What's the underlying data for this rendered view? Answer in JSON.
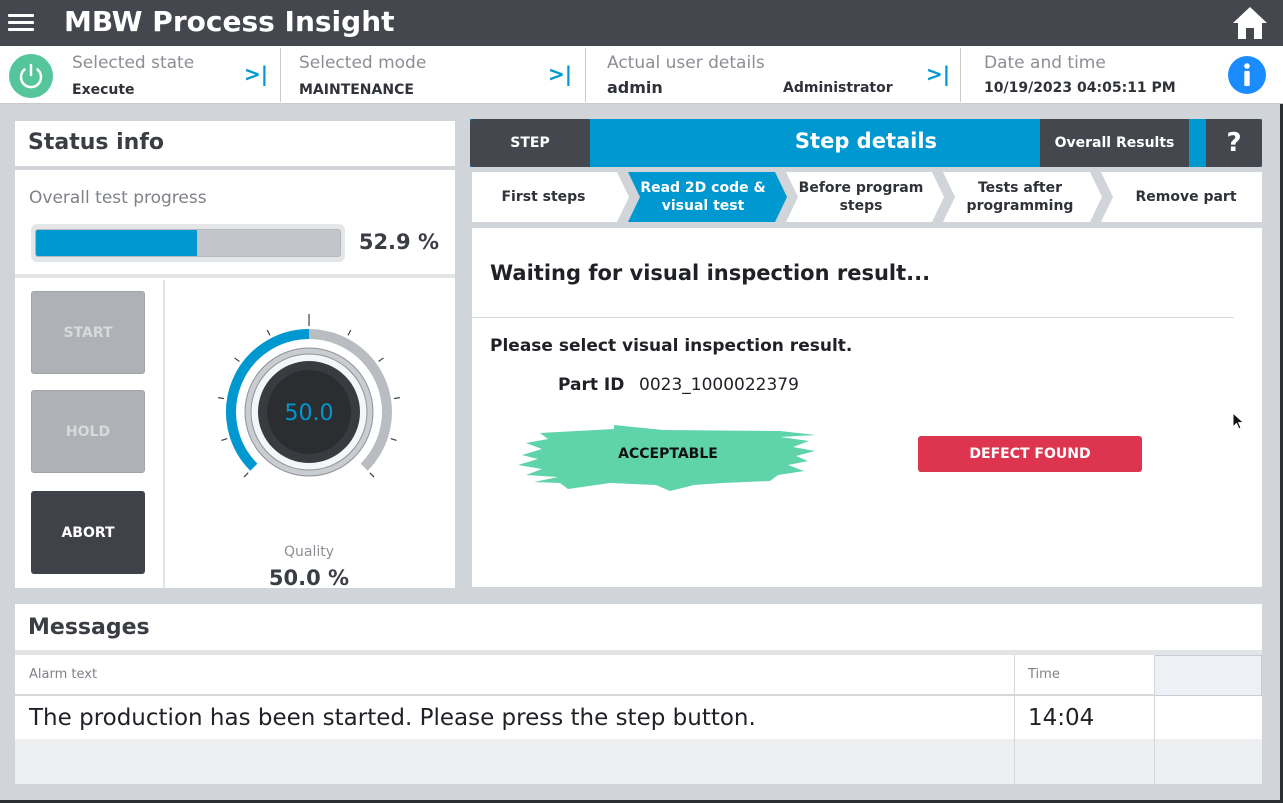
{
  "app": {
    "title": "MBW Process Insight"
  },
  "infobar": {
    "state": {
      "label": "Selected state",
      "value": "Execute"
    },
    "mode": {
      "label": "Selected mode",
      "value": "MAINTENANCE"
    },
    "user": {
      "label": "Actual user details",
      "name": "admin",
      "role": "Administrator"
    },
    "datetime": {
      "label": "Date and time",
      "value": "10/19/2023 04:05:11 PM"
    }
  },
  "status": {
    "title": "Status info",
    "progress_label": "Overall test progress",
    "progress_value": "52.9 %",
    "progress_fraction": 0.529,
    "buttons": {
      "start": "START",
      "hold": "HOLD",
      "abort": "ABORT"
    },
    "gauge_value": "50.0",
    "gauge_fraction": 0.5,
    "quality_label": "Quality",
    "quality_value": "50.0 %"
  },
  "step": {
    "step_button": "STEP",
    "title": "Step details",
    "overall_button": "Overall Results",
    "help_button": "?",
    "steps": [
      {
        "label": "First steps",
        "active": false
      },
      {
        "label": "Read 2D code & visual test",
        "active": true
      },
      {
        "label": "Before program steps",
        "active": false
      },
      {
        "label": "Tests after programming",
        "active": false
      },
      {
        "label": "Remove part",
        "active": false
      }
    ],
    "content_title": "Waiting for visual inspection result...",
    "content_subtitle": "Please select visual inspection result.",
    "part_id_label": "Part ID",
    "part_id_value": "0023_1000022379",
    "accept_button": "ACCEPTABLE",
    "defect_button": "DEFECT FOUND"
  },
  "messages": {
    "title": "Messages",
    "columns": {
      "alarm_text": "Alarm text",
      "time": "Time"
    },
    "rows": [
      {
        "text": "The production has been started. Please press the step button.",
        "time": "14:04"
      }
    ]
  },
  "colors": {
    "accent": "#0098d0",
    "topbar": "#44474e",
    "success": "#55c69c",
    "accept_brush": "#5fd3a9",
    "defect": "#dd3450",
    "info": "#1a8cff"
  },
  "icons": [
    "menu-icon",
    "home-icon",
    "power-icon",
    "chevron-right-bar-icon",
    "info-icon",
    "mouse-cursor-icon"
  ]
}
